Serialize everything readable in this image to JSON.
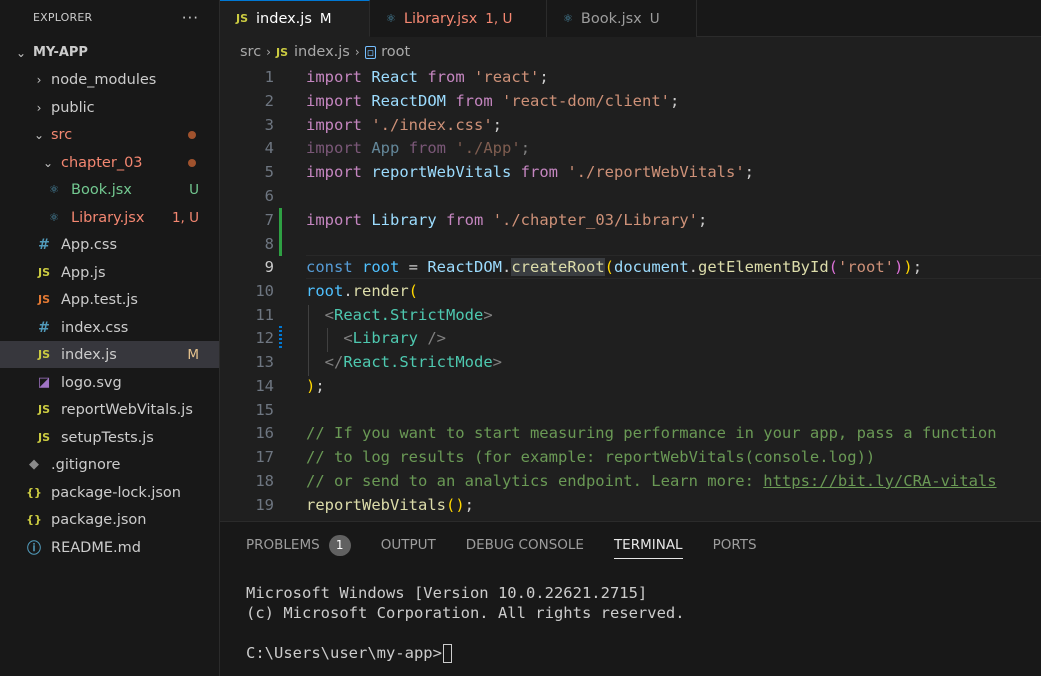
{
  "sidebar": {
    "title": "EXPLORER",
    "more": "···",
    "project": "MY-APP",
    "items": [
      {
        "label": "node_modules",
        "status": ""
      },
      {
        "label": "public",
        "status": ""
      },
      {
        "label": "src",
        "status": ""
      },
      {
        "label": "chapter_03",
        "status": ""
      },
      {
        "label": "Book.jsx",
        "status": "U"
      },
      {
        "label": "Library.jsx",
        "status": "1, U"
      },
      {
        "label": "App.css",
        "status": ""
      },
      {
        "label": "App.js",
        "status": ""
      },
      {
        "label": "App.test.js",
        "status": ""
      },
      {
        "label": "index.css",
        "status": ""
      },
      {
        "label": "index.js",
        "status": "M"
      },
      {
        "label": "logo.svg",
        "status": ""
      },
      {
        "label": "reportWebVitals.js",
        "status": ""
      },
      {
        "label": "setupTests.js",
        "status": ""
      },
      {
        "label": ".gitignore",
        "status": ""
      },
      {
        "label": "package-lock.json",
        "status": ""
      },
      {
        "label": "package.json",
        "status": ""
      },
      {
        "label": "README.md",
        "status": ""
      }
    ]
  },
  "tabs": [
    {
      "icon": "JS",
      "label": "index.js",
      "status": "M"
    },
    {
      "label": "Library.jsx",
      "status": "1, U"
    },
    {
      "label": "Book.jsx",
      "status": "U"
    }
  ],
  "breadcrumb": {
    "folder": "src",
    "file": "index.js",
    "symbol": "root"
  },
  "editor": {
    "line_numbers": [
      "1",
      "2",
      "3",
      "4",
      "5",
      "6",
      "7",
      "8",
      "9",
      "10",
      "11",
      "12",
      "13",
      "14",
      "15",
      "16",
      "17",
      "18",
      "19"
    ],
    "current_line": 9,
    "lines": {
      "l1": {
        "kw": "import",
        "id": "React",
        "from": "from",
        "str": "'react'",
        "end": ";"
      },
      "l2": {
        "kw": "import",
        "id": "ReactDOM",
        "from": "from",
        "str": "'react-dom/client'",
        "end": ";"
      },
      "l3": {
        "kw": "import",
        "str": "'./index.css'",
        "end": ";"
      },
      "l4": {
        "kw": "import",
        "id": "App",
        "from": "from",
        "str": "'./App'",
        "end": ";"
      },
      "l5": {
        "kw": "import",
        "id": "reportWebVitals",
        "from": "from",
        "str": "'./reportWebVitals'",
        "end": ";"
      },
      "l7": {
        "kw": "import",
        "id": "Library",
        "from": "from",
        "str": "'./chapter_03/Library'",
        "end": ";"
      },
      "l9": {
        "kw": "const",
        "var": "root",
        "eq": " = ",
        "obj": "ReactDOM",
        "dot": ".",
        "fn": "createRoot",
        "po": "(",
        "arg": "document",
        "dot2": ".",
        "fn2": "getElementById",
        "po2": "(",
        "str": "'root'",
        "pc2": ")",
        "pc": ")",
        "end": ";"
      },
      "l10": {
        "var": "root",
        "dot": ".",
        "fn": "render",
        "po": "("
      },
      "l11": {
        "lt": "<",
        "tag": "React.StrictMode",
        "gt": ">"
      },
      "l12": {
        "lt": "<",
        "tag": "Library",
        "gt": " />"
      },
      "l13": {
        "lt": "</",
        "tag": "React.StrictMode",
        "gt": ">"
      },
      "l14": {
        "pc": ")",
        "end": ";"
      },
      "l16": "// If you want to start measuring performance in your app, pass a function",
      "l17": "// to log results (for example: reportWebVitals(console.log))",
      "l18": {
        "text": "// or send to an analytics endpoint. Learn more: ",
        "url": "https://bit.ly/CRA-vitals"
      },
      "l19": {
        "fn": "reportWebVitals",
        "po": "()",
        "end": ";"
      }
    }
  },
  "panel": {
    "tabs": [
      "PROBLEMS",
      "OUTPUT",
      "DEBUG CONSOLE",
      "TERMINAL",
      "PORTS"
    ],
    "problems_count": "1",
    "active_tab": "TERMINAL",
    "terminal": {
      "line1": "Microsoft Windows [Version 10.0.22621.2715]",
      "line2": "(c) Microsoft Corporation. All rights reserved.",
      "prompt": "C:\\Users\\user\\my-app>"
    }
  }
}
